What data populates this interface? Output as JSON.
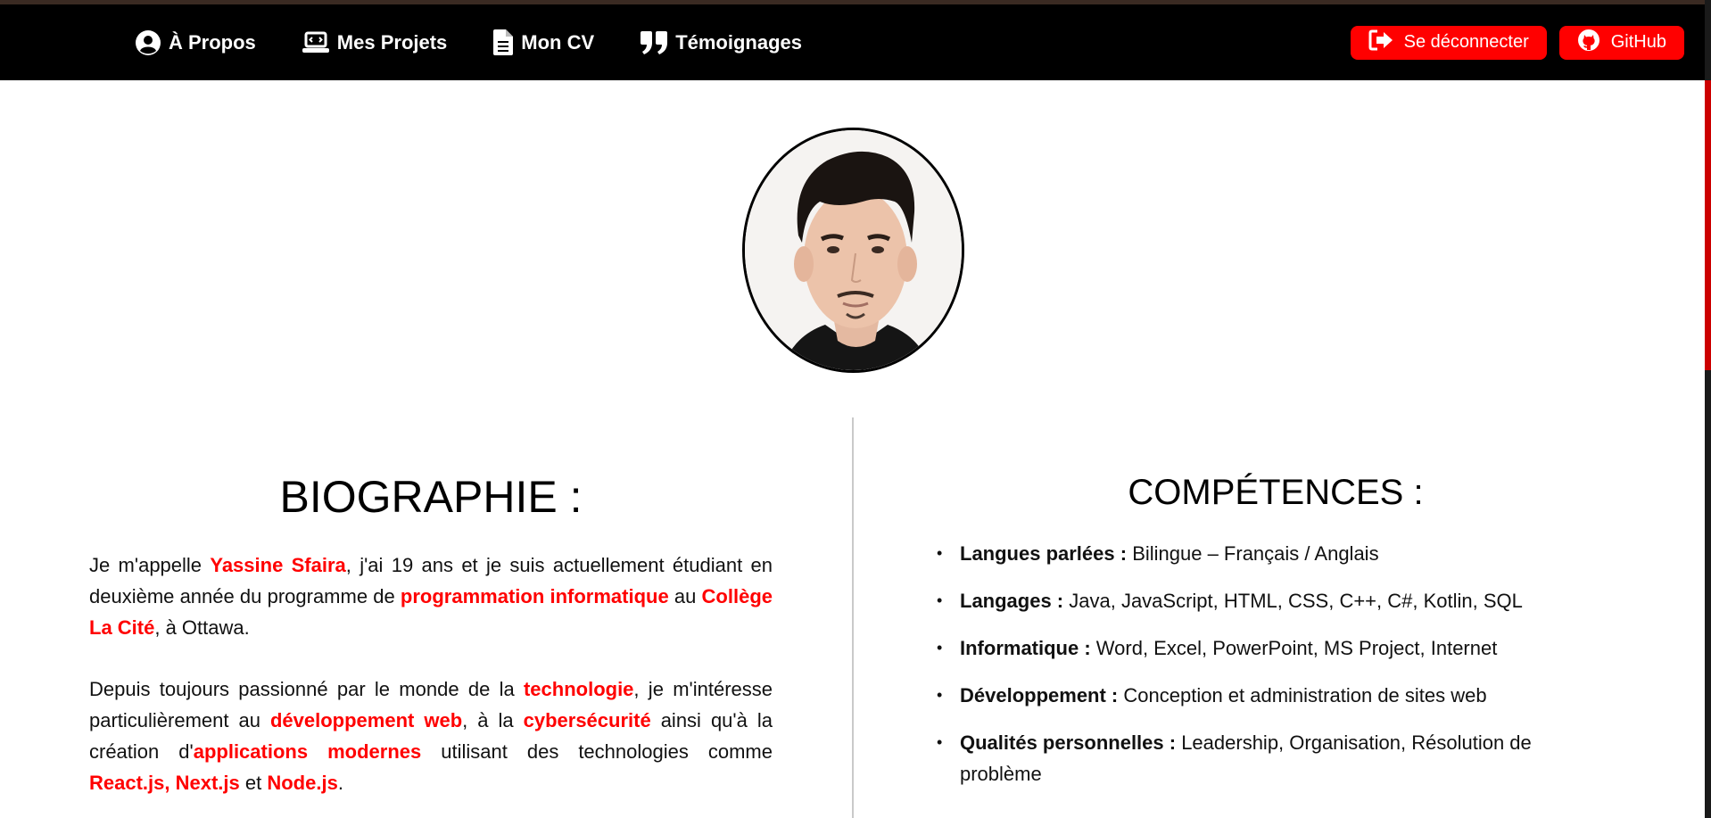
{
  "nav": {
    "items": [
      {
        "label": "À Propos",
        "icon": "user-circle-icon"
      },
      {
        "label": "Mes Projets",
        "icon": "laptop-code-icon"
      },
      {
        "label": "Mon CV",
        "icon": "file-icon"
      },
      {
        "label": "Témoignages",
        "icon": "quote-icon"
      }
    ],
    "logout_label": "Se déconnecter",
    "github_label": "GitHub"
  },
  "colors": {
    "accent": "#ff0000",
    "navbar": "#000000",
    "text": "#111111"
  },
  "profile": {
    "alt": "Photo de profil"
  },
  "bio": {
    "title": "BIOGRAPHIE :",
    "p1": {
      "t1": "Je m'appelle ",
      "name": "Yassine Sfaira",
      "t2": ", j'ai 19 ans et je suis actuellement étudiant en deuxième année du programme de ",
      "program": "programmation informatique",
      "t3": " au ",
      "college": "Collège La Cité",
      "t4": ", à Ottawa."
    },
    "p2": {
      "t1": "Depuis toujours passionné par le monde de la ",
      "tech": "technologie",
      "t2": ", je m'intéresse particulièrement au ",
      "webdev": "développement web",
      "t3": ", à la ",
      "cyber": "cybersécurité",
      "t4": " ainsi qu'à la création d'",
      "apps": "applications modernes",
      "t5": " utilisant des technologies comme ",
      "react": "React.js",
      "sep1": ", ",
      "next": "Next.js",
      "t6": " et ",
      "node": "Node.js",
      "t7": "."
    }
  },
  "skills": {
    "title": "COMPÉTENCES :",
    "items": [
      {
        "label": "Langues parlées :",
        "value": " Bilingue – Français / Anglais"
      },
      {
        "label": "Langages :",
        "value": " Java, JavaScript, HTML, CSS, C++, C#, Kotlin, SQL"
      },
      {
        "label": "Informatique :",
        "value": " Word, Excel, PowerPoint, MS Project, Internet"
      },
      {
        "label": "Développement :",
        "value": " Conception et administration de sites web"
      },
      {
        "label": "Qualités personnelles :",
        "value": " Leadership, Organisation, Résolution de problème"
      }
    ]
  }
}
